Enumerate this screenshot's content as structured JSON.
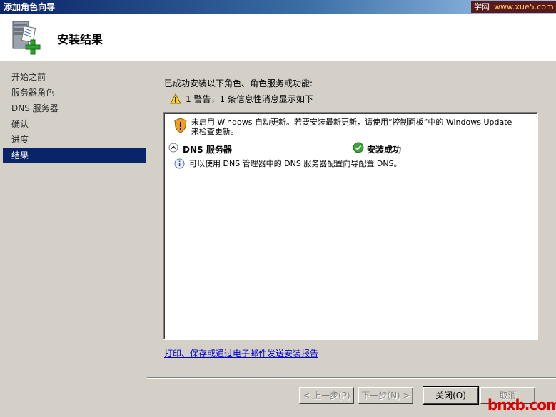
{
  "window": {
    "title": "添加角色向导"
  },
  "watermark": {
    "top_label": "学网",
    "top_site": "www.xue5.com",
    "bottom_text": "bnxb.com"
  },
  "header": {
    "title": "安装结果",
    "icon": "server-role-add-icon"
  },
  "nav": {
    "items": [
      {
        "label": "开始之前",
        "active": false
      },
      {
        "label": "服务器角色",
        "active": false
      },
      {
        "label": "DNS 服务器",
        "active": false
      },
      {
        "label": "确认",
        "active": false
      },
      {
        "label": "进度",
        "active": false
      },
      {
        "label": "结果",
        "active": true
      }
    ]
  },
  "main": {
    "intro": "已成功安装以下角色、角色服务或功能:",
    "summary": "1 警告，1 条信息性消息显示如下",
    "results": {
      "warning_line1": "未启用 Windows 自动更新。若要安装最新更新，请使用“控制面板”中的 Windows Update",
      "warning_line2": "来检查更新。",
      "role_name": "DNS 服务器",
      "role_status": "安装成功",
      "info": "可以使用 DNS 管理器中的 DNS 服务器配置向导配置 DNS。"
    },
    "report_link": "打印、保存或通过电子邮件发送安装报告"
  },
  "buttons": {
    "previous": "< 上一步(P)",
    "next": "下一步(N) >",
    "close": "关闭(O)",
    "cancel": "取消"
  },
  "colors": {
    "nav_active": "#0a246a",
    "link": "#0000cc",
    "background": "#d4d0c8"
  }
}
